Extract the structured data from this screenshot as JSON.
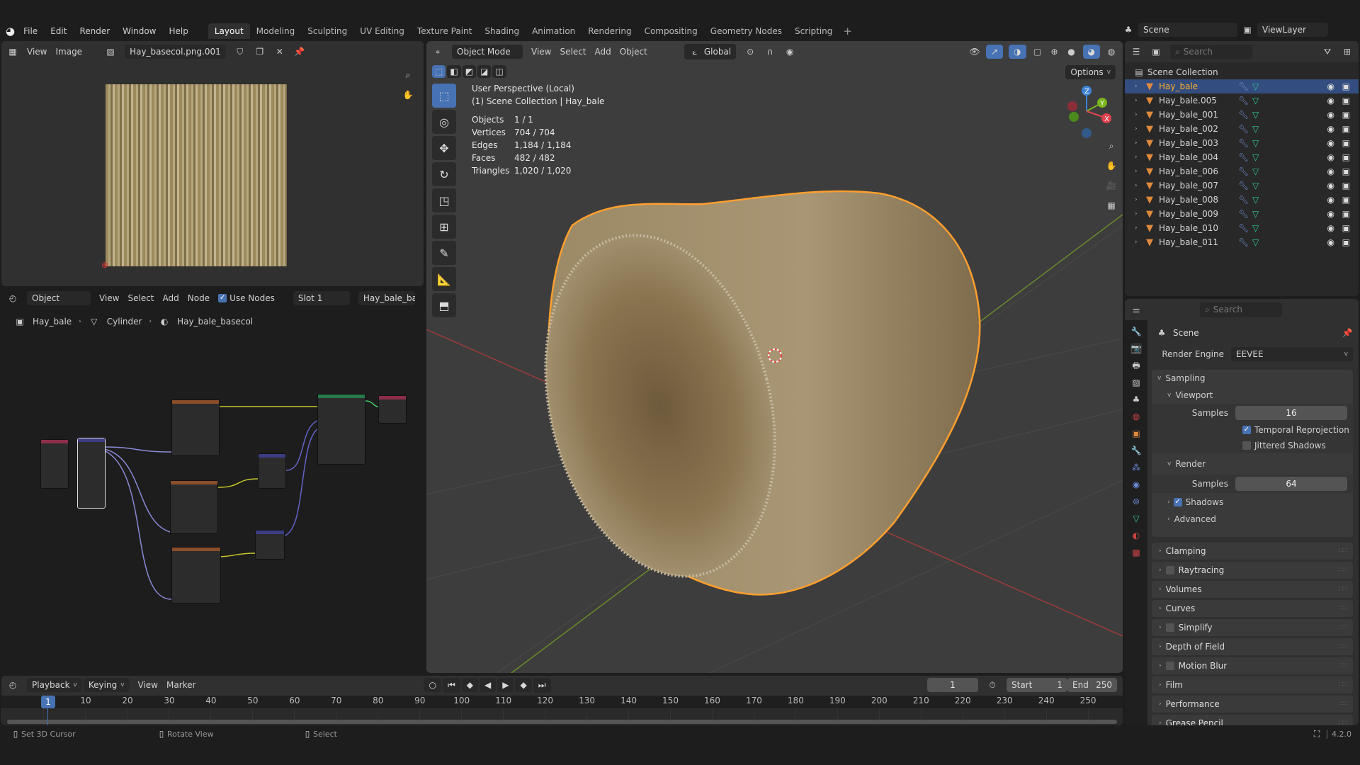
{
  "topbar": {
    "menus": [
      "File",
      "Edit",
      "Render",
      "Window",
      "Help"
    ],
    "workspaces": [
      "Layout",
      "Modeling",
      "Sculpting",
      "UV Editing",
      "Texture Paint",
      "Shading",
      "Animation",
      "Rendering",
      "Compositing",
      "Geometry Nodes",
      "Scripting"
    ],
    "active_workspace": "Layout",
    "add_workspace": "+",
    "scene": "Scene",
    "view_layer": "ViewLayer"
  },
  "image_editor": {
    "menus": [
      "View",
      "Image"
    ],
    "image_name": "Hay_basecol.png.001"
  },
  "node_editor": {
    "object_mode": "Object",
    "menus": [
      "View",
      "Select",
      "Add",
      "Node"
    ],
    "use_nodes_label": "Use Nodes",
    "use_nodes": true,
    "slot": "Slot 1",
    "material": "Hay_bale_basecol",
    "breadcrumb": [
      "Hay_bale",
      "Cylinder",
      "Hay_bale_basecol"
    ]
  },
  "viewport": {
    "mode": "Object Mode",
    "menus": [
      "View",
      "Select",
      "Add",
      "Object"
    ],
    "orientation": "Global",
    "options_label": "Options",
    "view_name": "User Perspective (Local)",
    "collection_line": "(1) Scene Collection | Hay_bale",
    "stats": [
      {
        "label": "Objects",
        "value": "1 / 1"
      },
      {
        "label": "Vertices",
        "value": "704 / 704"
      },
      {
        "label": "Edges",
        "value": "1,184 / 1,184"
      },
      {
        "label": "Faces",
        "value": "482 / 482"
      },
      {
        "label": "Triangles",
        "value": "1,020 / 1,020"
      }
    ],
    "gizmo": {
      "x": "X",
      "y": "Y",
      "z": "Z"
    }
  },
  "outliner": {
    "search_placeholder": "Search",
    "root": "Scene Collection",
    "items": [
      "Hay_bale",
      "Hay_bale.005",
      "Hay_bale_001",
      "Hay_bale_002",
      "Hay_bale_003",
      "Hay_bale_004",
      "Hay_bale_006",
      "Hay_bale_007",
      "Hay_bale_008",
      "Hay_bale_009",
      "Hay_bale_010",
      "Hay_bale_011"
    ],
    "selected": "Hay_bale"
  },
  "properties": {
    "search_placeholder": "Search",
    "context": "Scene",
    "render_engine_label": "Render Engine",
    "render_engine": "EEVEE",
    "sampling": "Sampling",
    "viewport": "Viewport",
    "viewport_samples_label": "Samples",
    "viewport_samples": "16",
    "temporal_reprojection": "Temporal Reprojection",
    "jittered_shadows": "Jittered Shadows",
    "render": "Render",
    "render_samples_label": "Samples",
    "render_samples": "64",
    "shadows": "Shadows",
    "advanced": "Advanced",
    "panels": [
      {
        "label": "Clamping",
        "checkbox": false
      },
      {
        "label": "Raytracing",
        "checkbox": true
      },
      {
        "label": "Volumes",
        "checkbox": false
      },
      {
        "label": "Curves",
        "checkbox": false
      },
      {
        "label": "Simplify",
        "checkbox": true
      },
      {
        "label": "Depth of Field",
        "checkbox": false
      },
      {
        "label": "Motion Blur",
        "checkbox": true
      },
      {
        "label": "Film",
        "checkbox": false
      },
      {
        "label": "Performance",
        "checkbox": false
      },
      {
        "label": "Grease Pencil",
        "checkbox": false
      }
    ]
  },
  "timeline": {
    "menus": [
      "Playback",
      "Keying",
      "View",
      "Marker"
    ],
    "current_frame": "1",
    "start_label": "Start",
    "start": "1",
    "end_label": "End",
    "end": "250",
    "ticks": [
      "10",
      "20",
      "30",
      "40",
      "50",
      "60",
      "70",
      "80",
      "90",
      "100",
      "110",
      "120",
      "130",
      "140",
      "150",
      "160",
      "170",
      "180",
      "190",
      "200",
      "210",
      "220",
      "230",
      "240",
      "250"
    ]
  },
  "statusbar": {
    "items": [
      "Set 3D Cursor",
      "Rotate View",
      "Select"
    ],
    "version": "4.2.0"
  },
  "colors": {
    "accent": "#4772b3",
    "selection": "#ffa033",
    "bg": "#303030"
  }
}
